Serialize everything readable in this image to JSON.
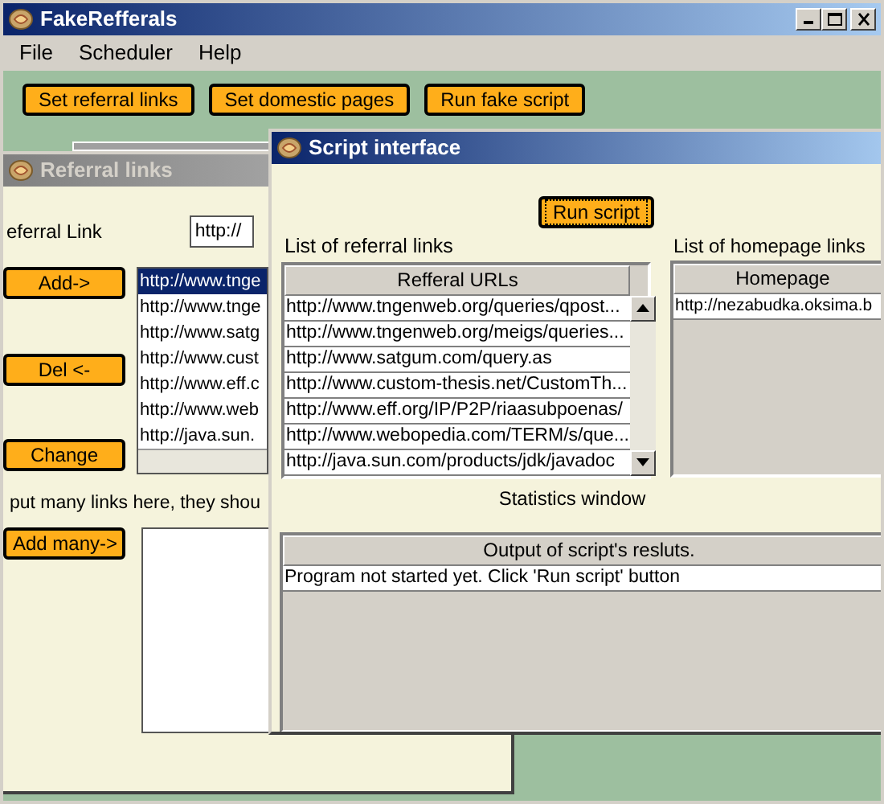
{
  "window": {
    "title": "FakeRefferals"
  },
  "menu": [
    "File",
    "Scheduler",
    "Help"
  ],
  "toolbar": [
    "Set referral links",
    "Set domestic pages",
    "Run fake script"
  ],
  "referral_frame": {
    "title": "Referral links",
    "active": false,
    "link_label": "eferral Link",
    "link_value": "http://",
    "buttons": [
      "Add->",
      "Del <-",
      "Change"
    ],
    "links": [
      {
        "text": "http://www.tnge",
        "selected": true
      },
      {
        "text": "http://www.tnge",
        "selected": false
      },
      {
        "text": "http://www.satg",
        "selected": false
      },
      {
        "text": "http://www.cust",
        "selected": false
      },
      {
        "text": "http://www.eff.c",
        "selected": false
      },
      {
        "text": "http://www.web",
        "selected": false
      },
      {
        "text": "http://java.sun.",
        "selected": false
      }
    ],
    "hint": "put many links here, they shou",
    "add_many_button": "Add many->"
  },
  "script_frame": {
    "title": "Script interface",
    "active": true,
    "run_button": "Run script",
    "referral_label": "List of referral links",
    "referral_table": {
      "columns": [
        "Refferal URLs"
      ],
      "rows": [
        [
          "http://www.tngenweb.org/queries/qpost..."
        ],
        [
          "http://www.tngenweb.org/meigs/queries..."
        ],
        [
          "http://www.satgum.com/query.as"
        ],
        [
          "http://www.custom-thesis.net/CustomTh..."
        ],
        [
          "http://www.eff.org/IP/P2P/riaasubpoenas/"
        ],
        [
          "http://www.webopedia.com/TERM/s/que..."
        ],
        [
          "http://java.sun.com/products/jdk/javadoc"
        ]
      ]
    },
    "homepage_label": "List of homepage links",
    "homepage_table": {
      "columns": [
        "Homepage"
      ],
      "rows": [
        [
          "http://nezabudka.oksima.b"
        ]
      ]
    },
    "statistics_label": "Statistics window",
    "output_table": {
      "columns": [
        "Output of script's resluts."
      ],
      "rows": [
        [
          "Program not started yet. Click 'Run script' button"
        ]
      ]
    }
  }
}
